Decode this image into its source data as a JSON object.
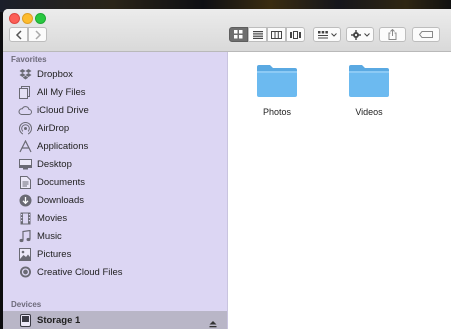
{
  "colors": {
    "sidebar_bg": "#dcd6f3",
    "folder_blue": "#65b3ea",
    "selected_bg": "#b9b6c7"
  },
  "toolbar": {
    "back_icon": "chevron-left-icon",
    "forward_icon": "chevron-right-icon",
    "view_modes": [
      "icon-view",
      "list-view",
      "column-view",
      "cover-flow-view"
    ],
    "selected_view": "icon-view",
    "arrange_icon": "arrange-grid-icon",
    "action_icon": "gear-icon",
    "share_icon": "share-icon",
    "tag_icon": "tag-icon"
  },
  "sidebar": {
    "favorites_header": "Favorites",
    "favorites": [
      {
        "label": "Dropbox",
        "icon": "dropbox-icon"
      },
      {
        "label": "All My Files",
        "icon": "all-files-icon"
      },
      {
        "label": "iCloud Drive",
        "icon": "cloud-icon"
      },
      {
        "label": "AirDrop",
        "icon": "airdrop-icon"
      },
      {
        "label": "Applications",
        "icon": "applications-icon"
      },
      {
        "label": "Desktop",
        "icon": "desktop-icon"
      },
      {
        "label": "Documents",
        "icon": "documents-icon"
      },
      {
        "label": "Downloads",
        "icon": "downloads-icon"
      },
      {
        "label": "Movies",
        "icon": "movies-icon"
      },
      {
        "label": "Music",
        "icon": "music-icon"
      },
      {
        "label": "Pictures",
        "icon": "pictures-icon"
      },
      {
        "label": "Creative Cloud Files",
        "icon": "creative-cloud-icon"
      }
    ],
    "devices_header": "Devices",
    "devices": [
      {
        "label": "Storage 1",
        "icon": "drive-icon",
        "selected": true,
        "eject": "eject-icon"
      }
    ]
  },
  "content": {
    "folders": [
      {
        "label": "Photos",
        "icon": "folder-icon"
      },
      {
        "label": "Videos",
        "icon": "folder-icon"
      }
    ]
  }
}
